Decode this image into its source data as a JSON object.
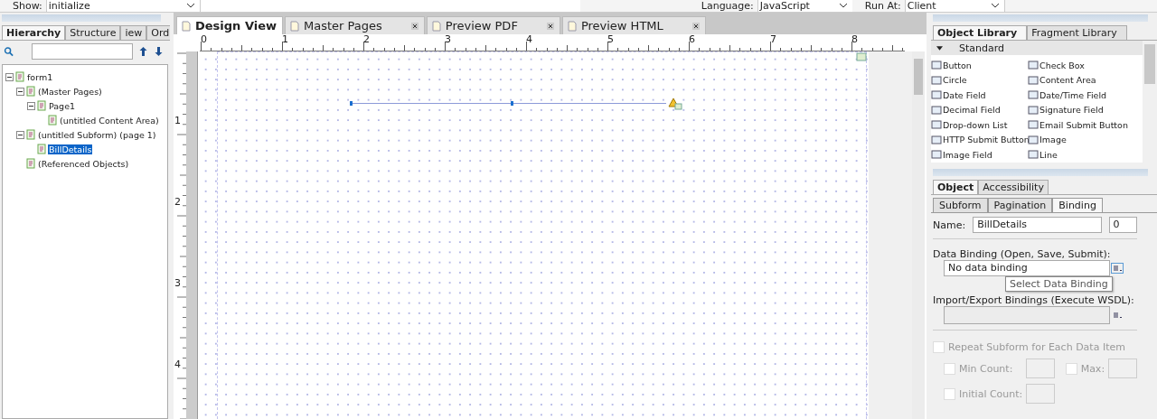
{
  "toolbar": {
    "show_label": "Show:",
    "show_value": "initialize",
    "language_label": "Language:",
    "language_value": "JavaScript",
    "run_at_label": "Run At:",
    "run_at_value": "Client"
  },
  "hierarchy_panel": {
    "tabs": [
      {
        "label": "Hierarchy",
        "selected": true
      },
      {
        "label": "Structure",
        "selected": false
      },
      {
        "label": "iew",
        "selected": false
      },
      {
        "label": "Ord",
        "selected": false
      }
    ],
    "tree": [
      {
        "label": "form1",
        "expanded": true,
        "selected": false,
        "children": [
          {
            "label": "(Master Pages)",
            "expanded": true,
            "selected": false,
            "children": [
              {
                "label": "Page1",
                "expanded": true,
                "selected": false,
                "children": [
                  {
                    "label": "(untitled Content Area)",
                    "selected": false
                  }
                ]
              }
            ]
          },
          {
            "label": "(untitled Subform) (page 1)",
            "expanded": true,
            "selected": false,
            "children": [
              {
                "label": "BillDetails",
                "selected": true
              }
            ]
          },
          {
            "label": "(Referenced Objects)",
            "selected": false
          }
        ]
      }
    ]
  },
  "document_tabs": [
    {
      "label": "Design View",
      "selected": true,
      "closable": false
    },
    {
      "label": "Master Pages",
      "selected": false,
      "closable": true
    },
    {
      "label": "Preview PDF",
      "selected": false,
      "closable": true
    },
    {
      "label": "Preview HTML",
      "selected": false,
      "closable": true
    }
  ],
  "rulers": {
    "horizontal": [
      "0",
      "1",
      "2",
      "3",
      "4",
      "5",
      "6",
      "7",
      "8"
    ],
    "vertical": [
      "1",
      "2",
      "3",
      "4"
    ]
  },
  "object_library": {
    "tabs": [
      {
        "label": "Object Library",
        "selected": true
      },
      {
        "label": "Fragment Library",
        "selected": false
      }
    ],
    "section": "Standard",
    "items": [
      "Button",
      "Check Box",
      "Circle",
      "Content Area",
      "Date Field",
      "Date/Time Field",
      "Decimal Field",
      "Signature Field",
      "Drop-down List",
      "Email Submit Button",
      "HTTP Submit Button",
      "Image",
      "Image Field",
      "Line"
    ]
  },
  "object_panel": {
    "tabs": [
      {
        "label": "Object",
        "selected": true
      },
      {
        "label": "Accessibility",
        "selected": false
      }
    ],
    "subtabs": [
      {
        "label": "Subform",
        "selected": false
      },
      {
        "label": "Pagination",
        "selected": false
      },
      {
        "label": "Binding",
        "selected": true
      }
    ],
    "name_label": "Name:",
    "name_value": "BillDetails",
    "name_index": "0",
    "data_binding_label": "Data Binding (Open, Save, Submit):",
    "data_binding_value": "No data binding",
    "tooltip": "Select Data Binding",
    "import_export_label": "Import/Export Bindings (Execute WSDL):",
    "options": [
      {
        "label": "Repeat Subform for Each Data Item",
        "checked": false,
        "disabled": true
      }
    ],
    "min_count": {
      "label": "Min Count:",
      "checked": false,
      "disabled": true
    },
    "max": {
      "label": "Max:",
      "checked": false,
      "disabled": true
    },
    "initial_count": {
      "label": "Initial Count:",
      "checked": false,
      "disabled": true
    }
  }
}
